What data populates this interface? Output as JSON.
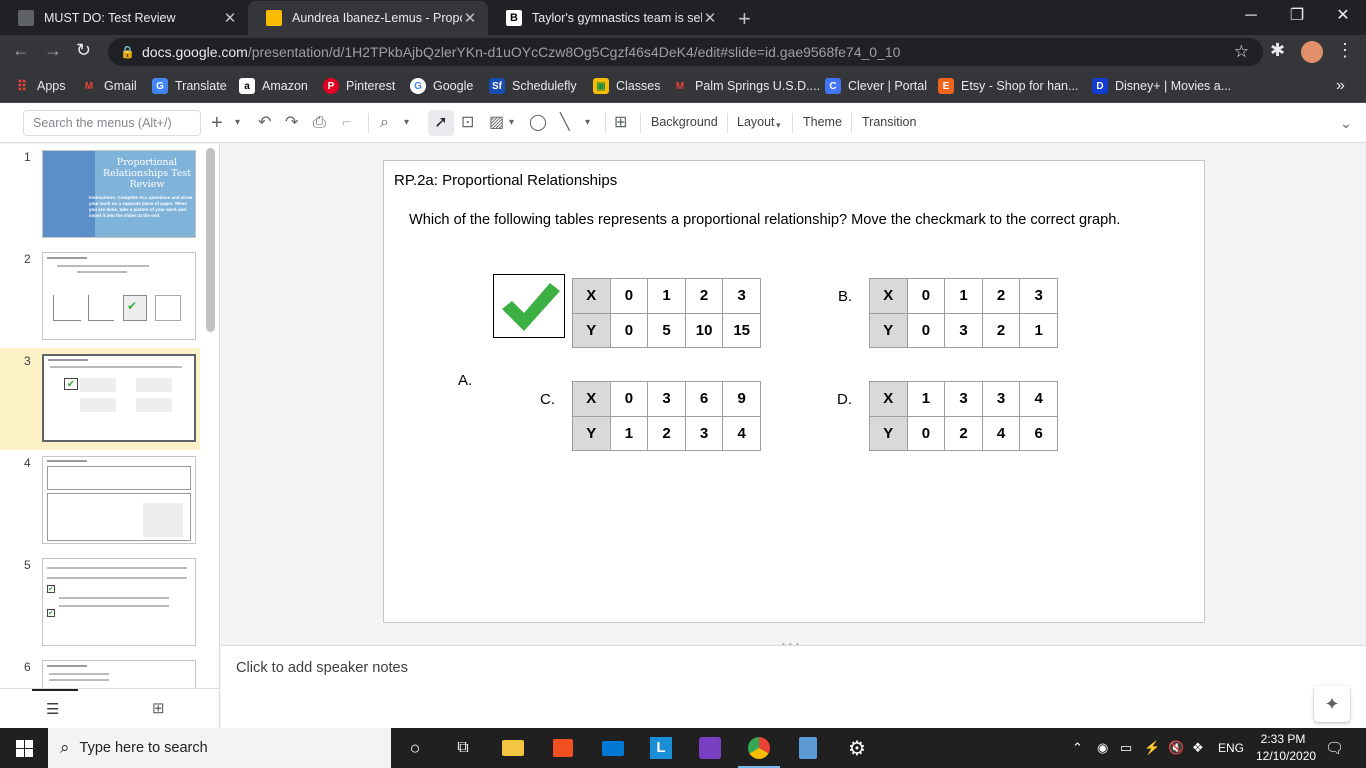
{
  "browser": {
    "tabs": [
      {
        "title": "MUST DO: Test Review",
        "active": false
      },
      {
        "title": "Aundrea Ibanez-Lemus - Proport",
        "active": true
      },
      {
        "title": "Taylor's gymnastics team is sellin",
        "active": false
      }
    ],
    "url_host": "docs.google.com",
    "url_path": "/presentation/d/1H2TPkbAjbQzlerYKn-d1uOYcCzw8Og5Cgzf46s4DeK4/edit#slide=id.gae9568fe74_0_10",
    "bookmarks": [
      {
        "label": "Apps",
        "icon": "apps-grid-icon",
        "color": "#ea4335"
      },
      {
        "label": "Gmail",
        "icon": "gmail-icon",
        "color": "#ea4335"
      },
      {
        "label": "Translate",
        "icon": "translate-icon",
        "color": "#4285f4"
      },
      {
        "label": "Amazon",
        "icon": "amazon-icon",
        "color": "#222222"
      },
      {
        "label": "Pinterest",
        "icon": "pinterest-icon",
        "color": "#e60023"
      },
      {
        "label": "Google",
        "icon": "google-icon",
        "color": "#ffffff"
      },
      {
        "label": "Schedulefly",
        "icon": "schedulefly-icon",
        "color": "#1a4db3"
      },
      {
        "label": "Classes",
        "icon": "classes-icon",
        "color": "#fbbc04"
      },
      {
        "label": "Palm Springs U.S.D....",
        "icon": "gmail-icon",
        "color": "#ea4335"
      },
      {
        "label": "Clever | Portal",
        "icon": "clever-icon",
        "color": "#4274f6"
      },
      {
        "label": "Etsy - Shop for han...",
        "icon": "etsy-icon",
        "color": "#f1641e"
      },
      {
        "label": "Disney+ | Movies a...",
        "icon": "disney-icon",
        "color": "#113ccf"
      }
    ]
  },
  "docs_toolbar": {
    "search_placeholder": "Search the menus (Alt+/)",
    "background": "Background",
    "layout": "Layout",
    "theme": "Theme",
    "transition": "Transition"
  },
  "filmstrip": {
    "numbers": [
      "1",
      "2",
      "3",
      "4",
      "5",
      "6"
    ],
    "selected": 3,
    "slide1_title": "Proportional Relationships Test Review",
    "slide1_body": "Instructions: Complete ALL questions and show your work on a separate piece of paper. When you are done, take a picture of your work and insert it into the slides at the end."
  },
  "slide": {
    "title": "RP.2a: Proportional Relationships",
    "question": "Which of the following tables represents a proportional relationship? Move the checkmark to the correct graph.",
    "tables": [
      {
        "label": "A.",
        "x": [
          "0",
          "1",
          "2",
          "3"
        ],
        "y": [
          "0",
          "5",
          "10",
          "15"
        ]
      },
      {
        "label": "B.",
        "x": [
          "0",
          "1",
          "2",
          "3"
        ],
        "y": [
          "0",
          "3",
          "2",
          "1"
        ]
      },
      {
        "label": "C.",
        "x": [
          "0",
          "3",
          "6",
          "9"
        ],
        "y": [
          "1",
          "2",
          "3",
          "4"
        ]
      },
      {
        "label": "D.",
        "x": [
          "1",
          "3",
          "3",
          "4"
        ],
        "y": [
          "0",
          "2",
          "4",
          "6"
        ]
      }
    ],
    "row_x": "X",
    "row_y": "Y"
  },
  "notes": {
    "placeholder": "Click to add speaker notes"
  },
  "taskbar": {
    "search_placeholder": "Type here to search",
    "language": "ENG",
    "time": "2:33 PM",
    "date": "12/10/2020"
  }
}
